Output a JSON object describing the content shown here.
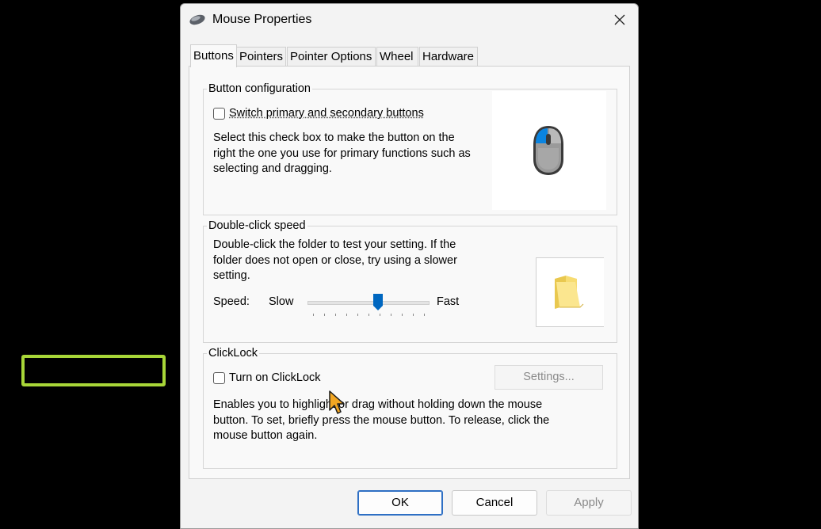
{
  "window": {
    "title": "Mouse Properties"
  },
  "tabs": [
    {
      "label": "Buttons",
      "active": true
    },
    {
      "label": "Pointers"
    },
    {
      "label": "Pointer Options"
    },
    {
      "label": "Wheel"
    },
    {
      "label": "Hardware"
    }
  ],
  "button_config": {
    "title": "Button configuration",
    "switch_label": "Switch primary and secondary buttons",
    "switch_checked": false,
    "description_lines": [
      "Select this check box to make the button on the",
      "right the one you use for primary functions such as",
      "selecting and dragging."
    ]
  },
  "double_click": {
    "title": "Double-click speed",
    "description_lines": [
      "Double-click the folder to test your setting. If the",
      "folder does not open or close, try using a slower",
      "setting."
    ],
    "speed_label": "Speed:",
    "slow_label": "Slow",
    "fast_label": "Fast",
    "speed_value": 0.58
  },
  "clicklock": {
    "title": "ClickLock",
    "turn_on_label": "Turn on ClickLock",
    "turn_on_checked": false,
    "settings_label": "Settings...",
    "description_lines": [
      "Enables you to highlight or drag without holding down the mouse",
      "button. To set, briefly press the mouse button. To release, click the",
      "mouse button again."
    ]
  },
  "footer": {
    "ok_label": "OK",
    "cancel_label": "Cancel",
    "apply_label": "Apply"
  },
  "colors": {
    "highlight": "#a8d638",
    "accent": "#0067c0"
  }
}
